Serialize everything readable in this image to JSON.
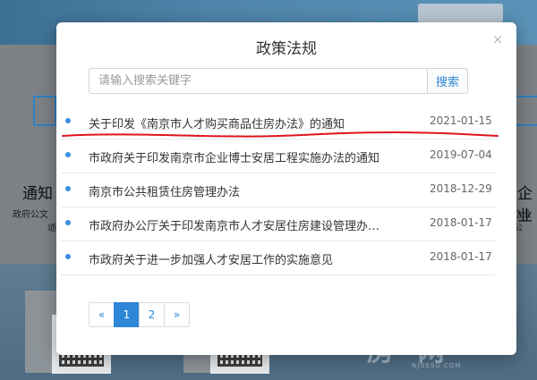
{
  "background": {
    "left_card_title": "通知",
    "left_card_line1": "政府公文",
    "left_card_line2": "项",
    "right_card_title": "企业",
    "right_card_line1": "企业公",
    "watermark": "房 网",
    "watermark_sub": "NJGESU.COM"
  },
  "modal": {
    "title": "政策法规",
    "close_glyph": "×",
    "search": {
      "placeholder": "请输入搜索关键字",
      "value": "",
      "button_label": "搜索"
    },
    "items": [
      {
        "title": "关于印发《南京市人才购买商品住房办法》的通知",
        "date": "2021-01-15"
      },
      {
        "title": "市政府关于印发南京市企业博士安居工程实施办法的通知",
        "date": "2019-07-04"
      },
      {
        "title": "南京市公共租赁住房管理办法",
        "date": "2018-12-29"
      },
      {
        "title": "市政府办公厅关于印发南京市人才安居住房建设管理办法的通知",
        "date": "2018-01-17"
      },
      {
        "title": "市政府关于进一步加强人才安居工作的实施意见",
        "date": "2018-01-17"
      }
    ],
    "pagination": {
      "prev": "«",
      "pages": [
        "1",
        "2"
      ],
      "current": "1",
      "next": "»"
    },
    "annotation_color": "#e0141e",
    "accent_color": "#2e86d6"
  }
}
